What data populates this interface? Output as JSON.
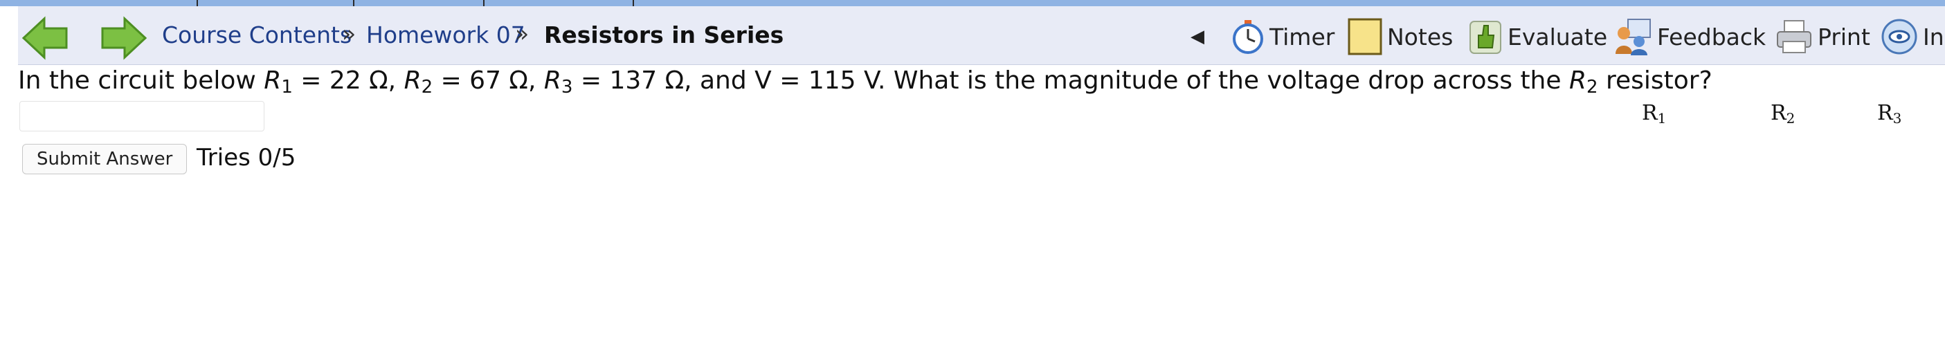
{
  "breadcrumb": {
    "course_contents": "Course Contents",
    "separator": "»",
    "homework": "Homework 07",
    "current": "Resistors in Series"
  },
  "toolbar": {
    "collapse_arrow": "◀",
    "timer": "Timer",
    "notes": "Notes",
    "evaluate": "Evaluate",
    "feedback": "Feedback",
    "print": "Print",
    "info": "In"
  },
  "question": {
    "p1": "In the circuit below ",
    "r1_sym": "R",
    "r1_sub": "1",
    "p2": " = 22 Ω, ",
    "r2_sym": "R",
    "r2_sub": "2",
    "p3": " = 67 Ω, ",
    "r3_sym": "R",
    "r3_sub": "3",
    "p4": " = 137 Ω, and V = 115 V. What is the magnitude of the voltage drop across the ",
    "r2b_sym": "R",
    "r2b_sub": "2",
    "p5": " resistor?"
  },
  "answer": {
    "value": "",
    "placeholder": ""
  },
  "submit": {
    "label": "Submit Answer"
  },
  "tries": {
    "text": "Tries 0/5"
  },
  "circuit_labels": [
    {
      "sym": "R",
      "sub": "1"
    },
    {
      "sym": "R",
      "sub": "2"
    },
    {
      "sym": "R",
      "sub": "3"
    }
  ],
  "colors": {
    "top_strip": "#8fb3e3",
    "navbar_bg": "#e8ebf6",
    "link": "#1f3e8a",
    "arrow_green": "#7cc043"
  },
  "icons": [
    "back-arrow-icon",
    "forward-arrow-icon",
    "timer-icon",
    "notes-icon",
    "evaluate-icon",
    "feedback-icon",
    "print-icon",
    "info-icon"
  ]
}
